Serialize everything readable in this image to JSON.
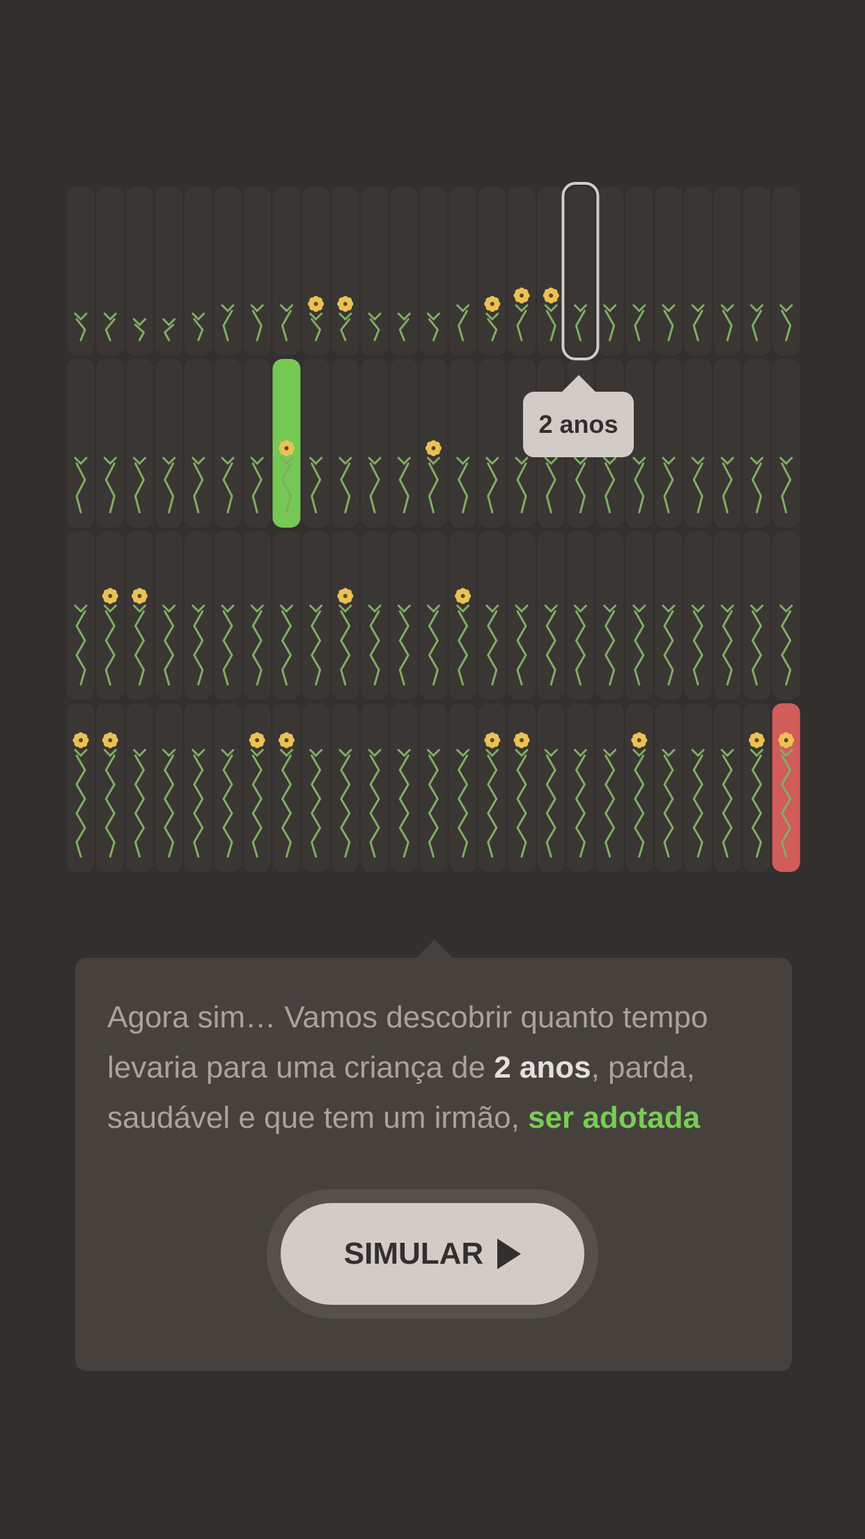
{
  "grid": {
    "rows": [
      {
        "stages": [
          1,
          1,
          0,
          0,
          1,
          2,
          2,
          2,
          1,
          1,
          1,
          1,
          1,
          2,
          1,
          2,
          2,
          2,
          2,
          2,
          2,
          2,
          2,
          2,
          2
        ],
        "flowers": [
          8,
          9,
          14,
          15,
          16
        ]
      },
      {
        "stages": [
          3,
          3,
          3,
          3,
          3,
          3,
          3,
          3,
          3,
          3,
          3,
          3,
          3,
          3,
          3,
          3,
          3,
          3,
          3,
          3,
          3,
          3,
          3,
          3,
          3
        ],
        "flowers": [
          7,
          12
        ]
      },
      {
        "stages": [
          4,
          4,
          4,
          4,
          4,
          4,
          4,
          4,
          4,
          4,
          4,
          4,
          4,
          4,
          4,
          4,
          4,
          4,
          4,
          4,
          4,
          4,
          4,
          4,
          4
        ],
        "flowers": [
          1,
          2,
          9,
          13
        ]
      },
      {
        "stages": [
          5,
          5,
          5,
          5,
          5,
          5,
          5,
          5,
          5,
          5,
          5,
          5,
          5,
          5,
          5,
          5,
          5,
          5,
          5,
          5,
          5,
          5,
          5,
          5,
          5
        ],
        "flowers": [
          0,
          1,
          6,
          7,
          14,
          15,
          19,
          23,
          24
        ]
      }
    ],
    "highlights": {
      "selected": {
        "row": 0,
        "col": 17
      },
      "adopted": {
        "row": 1,
        "col": 7
      },
      "last": {
        "row": 3,
        "col": 24
      }
    },
    "colors": {
      "cell_bg": "#3a3634",
      "stem": "#7fae63",
      "flower": "#ecc154",
      "flower_center": "#5a4a1e",
      "adopted": "#76c855",
      "last": "#d15c5a",
      "selected_border": "#d3cbc6"
    }
  },
  "tooltip": {
    "label": "2 anos"
  },
  "panel": {
    "text_before": "Agora sim… Vamos descobrir quanto tempo levaria para uma criança de ",
    "age": "2 anos",
    "text_middle": ", parda, saudável e que tem um irmão, ",
    "highlight": "ser adotada"
  },
  "button": {
    "label": "SIMULAR",
    "icon": "play-icon"
  }
}
